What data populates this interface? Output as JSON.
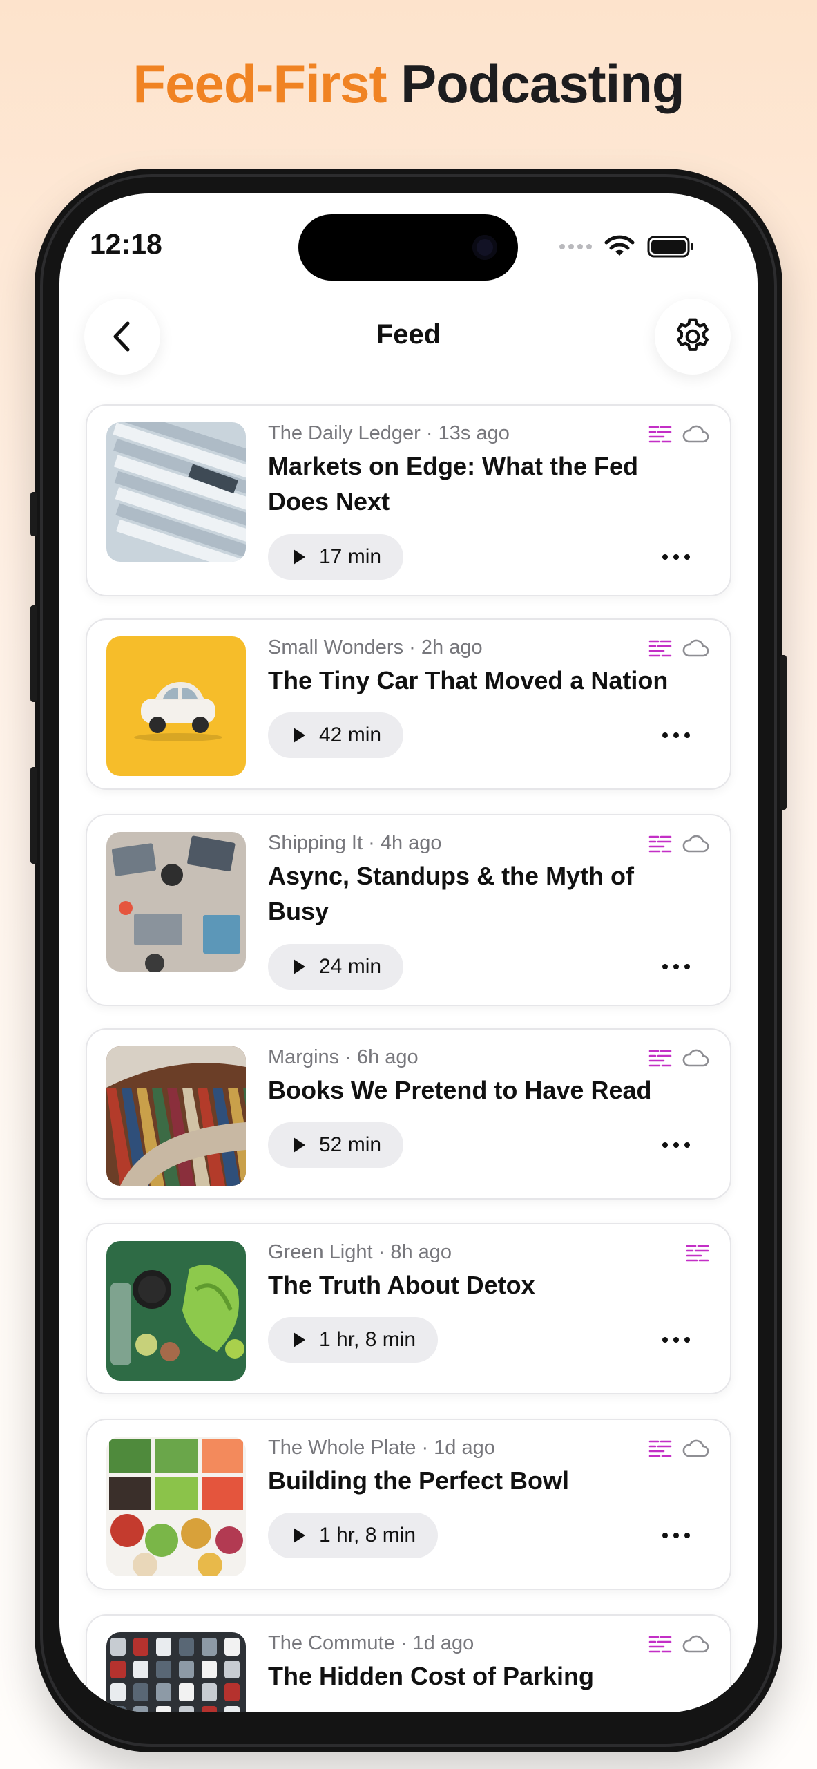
{
  "headline": {
    "accent": "Feed-First",
    "rest": "Podcasting"
  },
  "status": {
    "time": "12:18"
  },
  "nav": {
    "title": "Feed"
  },
  "colors": {
    "accent": "#f08323",
    "transcript_icon": "#c32fc6",
    "cloud_icon": "#8e8e93"
  },
  "episodes": [
    {
      "show": "The Daily Ledger",
      "age": "13s ago",
      "title": "Markets on Edge: What the Fed Does Next",
      "duration": "17 min",
      "icons": [
        "transcript-icon",
        "cloud-icon"
      ]
    },
    {
      "show": "Small Wonders",
      "age": "2h ago",
      "title": "The Tiny Car That Moved a Nation",
      "duration": "42 min",
      "icons": [
        "transcript-icon",
        "cloud-icon"
      ]
    },
    {
      "show": "Shipping It",
      "age": "4h ago",
      "title": "Async, Standups & the Myth of Busy",
      "duration": "24 min",
      "icons": [
        "transcript-icon",
        "cloud-icon"
      ]
    },
    {
      "show": "Margins",
      "age": "6h ago",
      "title": "Books We Pretend to Have Read",
      "duration": "52 min",
      "icons": [
        "transcript-icon",
        "cloud-icon"
      ]
    },
    {
      "show": "Green Light",
      "age": "8h ago",
      "title": "The Truth About Detox",
      "duration": "1 hr, 8 min",
      "icons": [
        "transcript-icon"
      ]
    },
    {
      "show": "The Whole Plate",
      "age": "1d ago",
      "title": "Building the Perfect Bowl",
      "duration": "1 hr, 8 min",
      "icons": [
        "transcript-icon",
        "cloud-icon"
      ]
    },
    {
      "show": "The Commute",
      "age": "1d ago",
      "title": "The Hidden Cost of Parking",
      "duration": "",
      "icons": [
        "transcript-icon",
        "cloud-icon"
      ]
    }
  ]
}
